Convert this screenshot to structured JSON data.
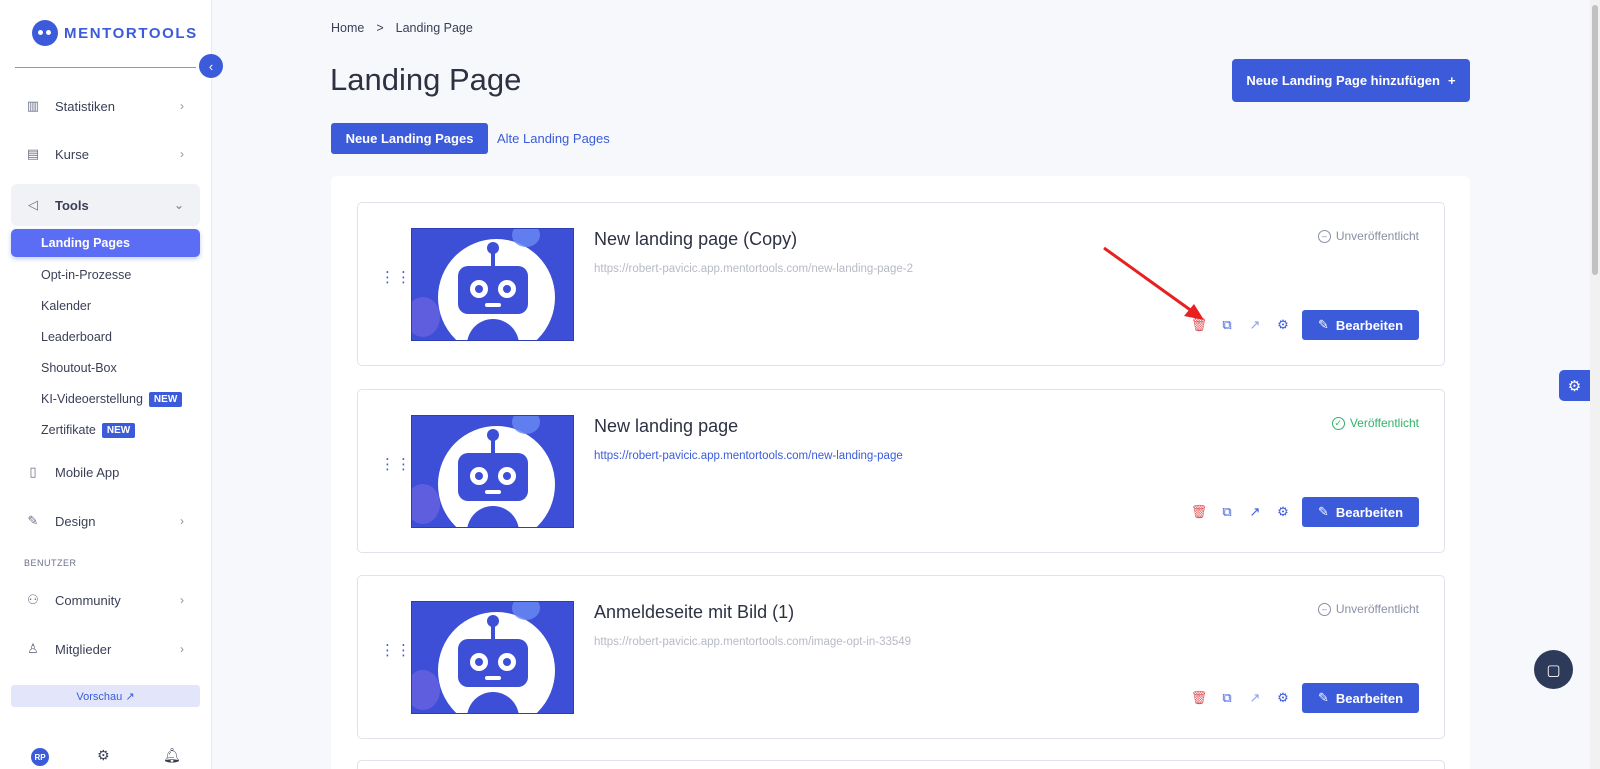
{
  "brand": {
    "name": "MENTORTOOLS"
  },
  "sidebar": {
    "nav": [
      {
        "label": "Statistiken",
        "icon": "bar-chart-icon"
      },
      {
        "label": "Kurse",
        "icon": "book-icon"
      },
      {
        "label": "Tools",
        "icon": "megaphone-icon"
      }
    ],
    "tools_sub": [
      {
        "label": "Landing Pages"
      },
      {
        "label": "Opt-in-Prozesse"
      },
      {
        "label": "Kalender"
      },
      {
        "label": "Leaderboard"
      },
      {
        "label": "Shoutout-Box"
      },
      {
        "label": "KI-Videoerstellung",
        "badge": "NEW"
      },
      {
        "label": "Zertifikate",
        "badge": "NEW"
      }
    ],
    "nav2": [
      {
        "label": "Mobile App",
        "icon": "phone-icon"
      },
      {
        "label": "Design",
        "icon": "pen-icon"
      }
    ],
    "section_label": "BENUTZER",
    "nav3": [
      {
        "label": "Community",
        "icon": "users-icon"
      },
      {
        "label": "Mitglieder",
        "icon": "user-icon"
      }
    ],
    "preview_label": "Vorschau ↗",
    "avatar_initials": "RP"
  },
  "breadcrumb": {
    "home": "Home",
    "separator": ">",
    "current": "Landing Page"
  },
  "page": {
    "title": "Landing Page",
    "add_button": "Neue Landing Page hinzufügen",
    "tabs": {
      "active": "Neue Landing Pages",
      "other": "Alte Landing Pages"
    }
  },
  "cards": [
    {
      "title": "New landing page (Copy)",
      "url": "https://robert-pavicic.app.mentortools.com/new-landing-page-2",
      "status": "Unveröffentlicht",
      "published": false,
      "edit_label": "Bearbeiten"
    },
    {
      "title": "New landing page",
      "url": "https://robert-pavicic.app.mentortools.com/new-landing-page",
      "status": "Veröffentlicht",
      "published": true,
      "edit_label": "Bearbeiten"
    },
    {
      "title": "Anmeldeseite mit Bild (1)",
      "url": "https://robert-pavicic.app.mentortools.com/image-opt-in-33549",
      "status": "Unveröffentlicht",
      "published": false,
      "edit_label": "Bearbeiten"
    }
  ],
  "colors": {
    "accent": "#3b5bdb",
    "published": "#2fb36a",
    "delete": "#e0565b",
    "arrow": "#e8201f"
  }
}
